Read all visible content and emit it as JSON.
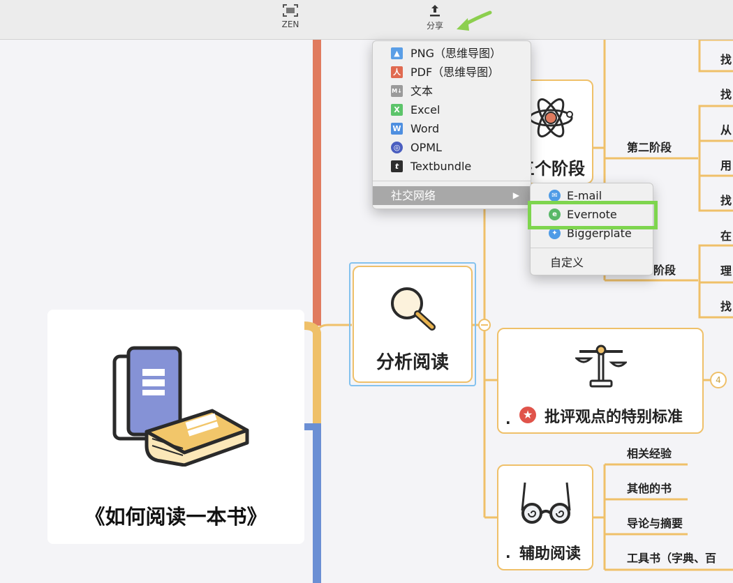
{
  "toolbar": {
    "zen_label": "ZEN",
    "share_label": "分享"
  },
  "colors": {
    "branch_orange": "#efc069",
    "branch_red": "#e07b5f",
    "branch_blue": "#6b8fd4",
    "highlight_green": "#7ed54e",
    "arrow_green": "#8ccf4e"
  },
  "export_menu": {
    "items": [
      {
        "icon": "png-image-icon",
        "label": "PNG（思维导图）"
      },
      {
        "icon": "pdf-file-icon",
        "label": "PDF（思维导图）"
      },
      {
        "icon": "markdown-icon",
        "label": "文本"
      },
      {
        "icon": "excel-icon",
        "label": "Excel"
      },
      {
        "icon": "word-icon",
        "label": "Word"
      },
      {
        "icon": "opml-icon",
        "label": "OPML"
      },
      {
        "icon": "textbundle-icon",
        "label": "Textbundle"
      }
    ],
    "social_label": "社交网络"
  },
  "social_menu": {
    "items": [
      {
        "icon": "email-icon",
        "label": "E-mail"
      },
      {
        "icon": "evernote-icon",
        "label": "Evernote"
      },
      {
        "icon": "biggerplate-icon",
        "label": "Biggerplate"
      }
    ],
    "custom_label": "自定义"
  },
  "mindmap": {
    "root_title": "《如何阅读一本书》",
    "analysis_node": "分析阅读",
    "stages_node_partial": "三个阶段",
    "critique_node": "批评观点的特别标准",
    "critique_count": "4",
    "aux_node": "辅助阅读",
    "stage2_label": "第二阶段",
    "stage3_label_partial": "阶段",
    "right_edge_labels": [
      "找",
      "找",
      "从",
      "用",
      "找",
      "在",
      "理",
      "找"
    ],
    "aux_children": [
      "相关经验",
      "其他的书",
      "导论与摘要",
      "工具书（字典、百"
    ]
  }
}
